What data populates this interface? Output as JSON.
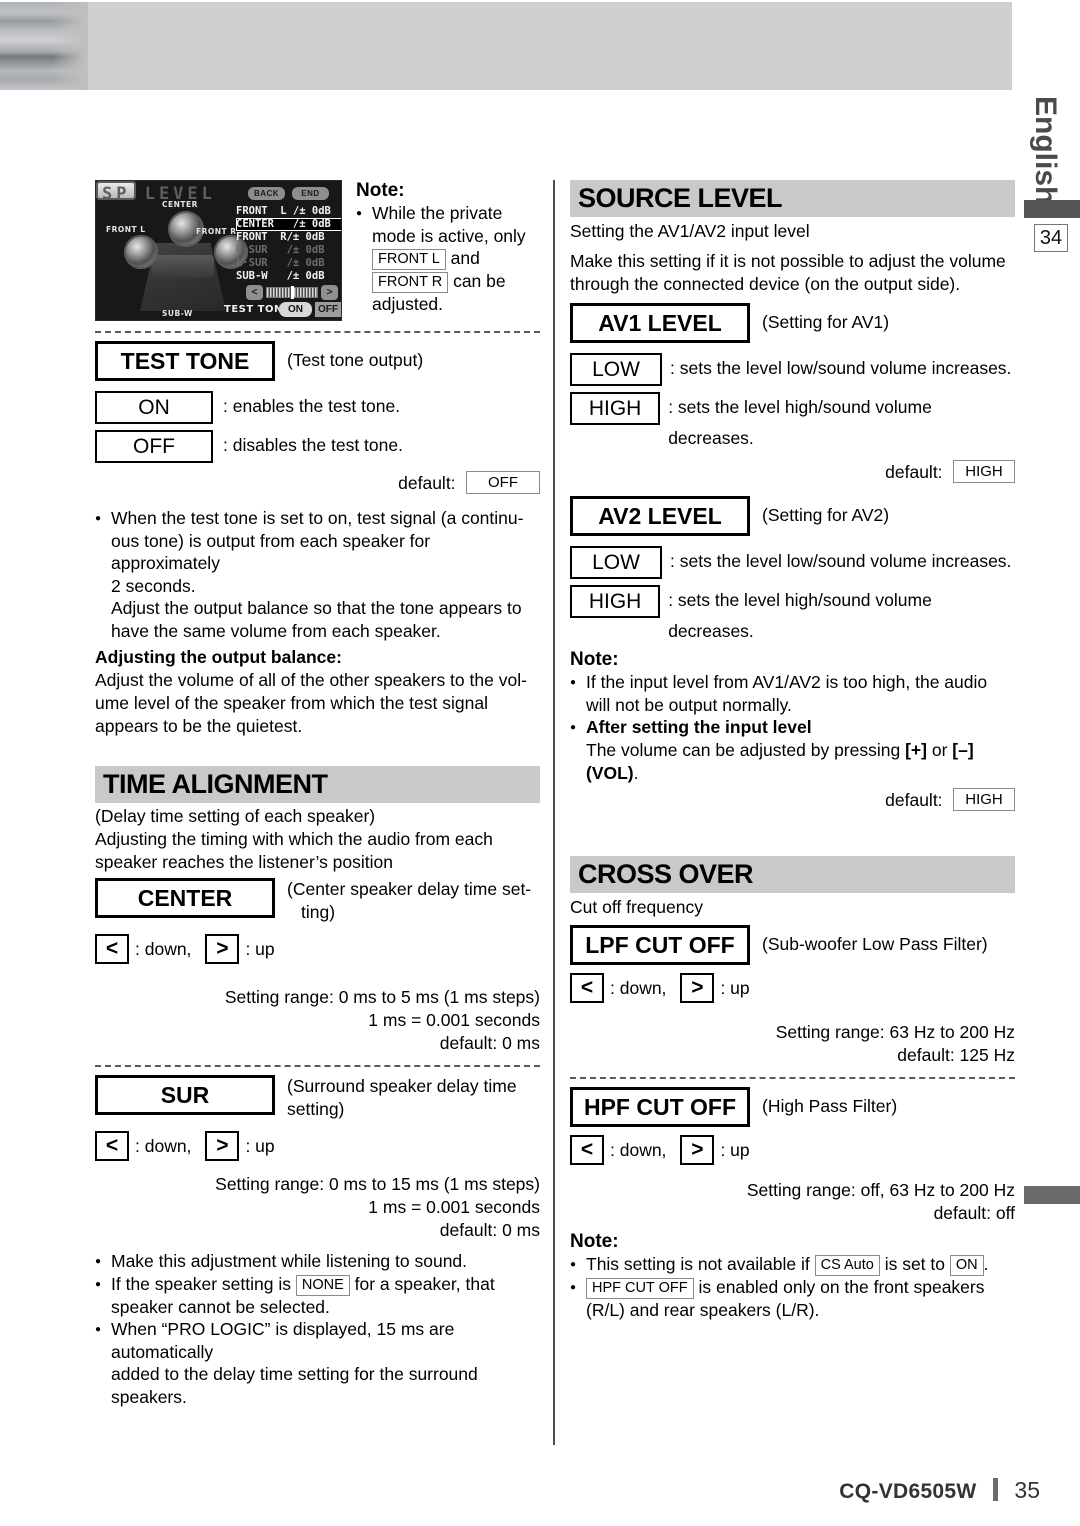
{
  "page": {
    "language_tab": "English",
    "side_page_ref": "34",
    "footer_model": "CQ-VD6505W",
    "footer_page": "35"
  },
  "lcd": {
    "title": "SP LEVEL",
    "back_button": "BACK",
    "end_button": "END",
    "speaker_labels": {
      "center": "CENTER",
      "front_l": "FRONT L",
      "front_r": "FRONT R",
      "sub_w": "SUB-W"
    },
    "levels": [
      {
        "label": "FRONT  L /±",
        "value": "0dB",
        "state": "normal"
      },
      {
        "label": "CENTER   /±",
        "value": "0dB",
        "state": "selected"
      },
      {
        "label": "FRONT  R/±",
        "value": "0dB",
        "state": "normal"
      },
      {
        "label": "R·SUR   /±",
        "value": "0dB",
        "state": "dim"
      },
      {
        "label": "L·SUR   /±",
        "value": "0dB",
        "state": "dim"
      },
      {
        "label": "SUB-W   /±",
        "value": "0dB",
        "state": "normal"
      }
    ],
    "slider_left": "<",
    "slider_right": ">",
    "test_tone_label": "TEST TONE",
    "test_tone_on": "ON",
    "test_tone_off": "OFF"
  },
  "note_top": {
    "heading": "Note:",
    "line1": "While the private",
    "line2": "mode is active, only",
    "key_front_l": "FRONT L",
    "and": "and",
    "key_front_r": "FRONT R",
    "can_be": "can be",
    "line3": "adjusted."
  },
  "test_tone": {
    "title": "TEST TONE",
    "subtitle": "(Test tone output)",
    "options": [
      {
        "key": "ON",
        "desc": ": enables the test tone."
      },
      {
        "key": "OFF",
        "desc": ": disables the test tone."
      }
    ],
    "default_label": "default:",
    "default_value": "OFF",
    "bullet1_l1": "When the test tone is set to on,  test signal (a continu-",
    "bullet1_l2": "ous tone) is output from each speaker for approximately",
    "bullet1_l3": "2 seconds.",
    "bullet1_l4": "Adjust the output balance so that the tone appears to",
    "bullet1_l5": "have the same volume from each speaker.",
    "balance_heading": "Adjusting the output balance:",
    "balance_l1": "Adjust the volume of all of the other speakers to the vol-",
    "balance_l2": "ume level of the speaker from which the test signal",
    "balance_l3": "appears to be the quietest."
  },
  "time_alignment": {
    "title": "TIME ALIGNMENT",
    "sub1": "(Delay time setting of each speaker)",
    "sub2": "Adjusting the timing with which the audio from each",
    "sub3": "speaker reaches the listener’s position",
    "center": {
      "key": "CENTER",
      "caption_l1": "(Center speaker delay time set-",
      "caption_l2": "ting)",
      "arrow_down": "<",
      "down_text": ": down,",
      "arrow_up": ">",
      "up_text": ": up",
      "range_l1": "Setting range: 0 ms to 5 ms (1 ms steps)",
      "range_l2": "1 ms = 0.001 seconds",
      "range_l3": "default: 0 ms"
    },
    "sur": {
      "key": "SUR",
      "caption_l1": "(Surround speaker delay time",
      "caption_l2": "setting)",
      "arrow_down": "<",
      "down_text": ": down,",
      "arrow_up": ">",
      "up_text": ": up",
      "range_l1": "Setting range: 0 ms to 15 ms (1 ms steps)",
      "range_l2": "1 ms = 0.001 seconds",
      "range_l3": "default: 0 ms"
    },
    "notes": {
      "b1": "Make this adjustment while listening to sound.",
      "b2_pre": "If the speaker setting is",
      "b2_key": "NONE",
      "b2_post": "for a speaker, that",
      "b2_l2": "speaker cannot be selected.",
      "b3_l1": "When “PRO LOGIC” is displayed, 15 ms are automatically",
      "b3_l2": "added to the delay time setting for the surround speakers."
    }
  },
  "source_level": {
    "title": "SOURCE LEVEL",
    "sub1": "Setting the AV1/AV2 input level",
    "sub2": "Make this setting if it is not possible to adjust the volume",
    "sub3": "through the connected device (on the output side).",
    "av1": {
      "key": "AV1 LEVEL",
      "caption": "(Setting for AV1)",
      "options": [
        {
          "key": "LOW",
          "desc": ": sets the level low/sound volume increases."
        },
        {
          "key": "HIGH",
          "desc": ": sets the level high/sound volume decreases."
        }
      ],
      "default_label": "default:",
      "default_value": "HIGH"
    },
    "av2": {
      "key": "AV2 LEVEL",
      "caption": "(Setting for AV2)",
      "options": [
        {
          "key": "LOW",
          "desc": ": sets the level low/sound volume increases."
        },
        {
          "key": "HIGH",
          "desc": ": sets the level high/sound volume decreases."
        }
      ],
      "default_label": "default:",
      "default_value": "HIGH"
    },
    "note": {
      "heading": "Note:",
      "b1_l1": "If the input level from AV1/AV2 is too high, the audio",
      "b1_l2": "will not be output normally.",
      "b2_heading": "After setting the input level",
      "b2_l1_pre": "The volume can be adjusted by pressing",
      "b2_plus": "[+]",
      "b2_or": "or",
      "b2_minus": "[–]",
      "b2_l2": "(VOL)",
      "b2_period": "."
    }
  },
  "cross_over": {
    "title": "CROSS OVER",
    "sub1": "Cut off frequency",
    "lpf": {
      "key": "LPF CUT OFF",
      "caption": "(Sub-woofer Low Pass Filter)",
      "arrow_down": "<",
      "down_text": ": down,",
      "arrow_up": ">",
      "up_text": ": up",
      "range_l1": "Setting range: 63 Hz to 200 Hz",
      "range_l2": "default: 125 Hz"
    },
    "hpf": {
      "key": "HPF CUT OFF",
      "caption": "(High Pass Filter)",
      "arrow_down": "<",
      "down_text": ": down,",
      "arrow_up": ">",
      "up_text": ": up",
      "range_l1": "Setting range: off, 63 Hz to 200 Hz",
      "range_l2": "default: off"
    },
    "note": {
      "heading": "Note:",
      "b1_pre": "This setting is not available if",
      "b1_key": "CS Auto",
      "b1_mid": "is set to",
      "b1_key2": "ON",
      "b1_post": ".",
      "b2_key": "HPF CUT OFF",
      "b2_post": "is enabled only on the front speakers",
      "b2_l2": "(R/L) and rear speakers (L/R)."
    }
  }
}
